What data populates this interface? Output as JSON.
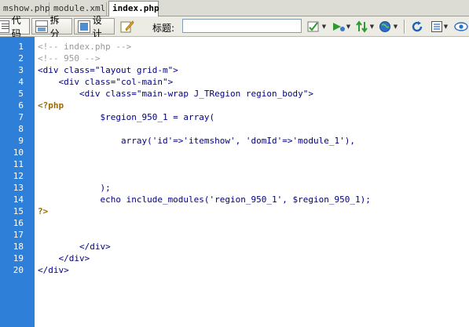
{
  "tabs": [
    "mshow.php",
    "module.xml",
    "index.php"
  ],
  "active_tab": "index.php",
  "toolbar": {
    "code_label": "代码",
    "split_label": "拆分",
    "design_label": "设计",
    "title_label": "标题:",
    "title_value": ""
  },
  "icons": [
    "live-view-icon",
    "validate-icon",
    "preview-icon",
    "file-management-icon",
    "browser-check-icon",
    "refresh-icon",
    "view-options-icon",
    "visual-aids-icon"
  ],
  "line_numbers": [
    "1",
    "2",
    "3",
    "4",
    "5",
    "6",
    "7",
    "8",
    "9",
    "10",
    "11",
    "12",
    "13",
    "14",
    "15",
    "16",
    "17",
    "18",
    "19",
    "20"
  ],
  "code_lines": [
    "<!-- index.php -->",
    "<!-- 950 -->",
    "<div class=\"layout grid-m\">",
    "    <div class=\"col-main\">",
    "        <div class=\"main-wrap J_TRegion region_body\">",
    "<?php",
    "            $region_950_1 = array(",
    "",
    "                array('id'=>'itemshow', 'domId'=>'module_1'),",
    "",
    "",
    "",
    "            );",
    "            echo include_modules('region_950_1', $region_950_1);",
    "?>",
    "",
    "",
    "        </div>",
    "    </div>",
    "</div>"
  ],
  "colors": {
    "gutter": "#2e7fd8",
    "code_text": "#000080",
    "comment": "#9a9a9a",
    "php_tag": "#9c6a00"
  }
}
